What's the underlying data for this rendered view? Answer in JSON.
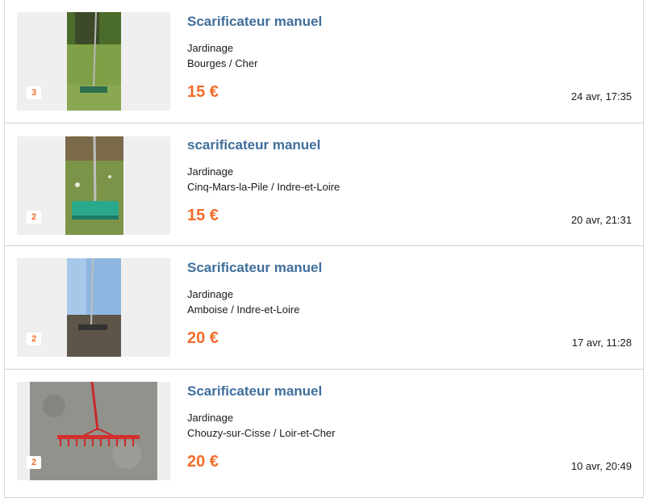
{
  "listings": [
    {
      "title": "Scarificateur manuel",
      "category": "Jardinage",
      "location": "Bourges / Cher",
      "price": "15 €",
      "date": "24 avr, 17:35",
      "photo_count": "3"
    },
    {
      "title": "scarificateur manuel",
      "category": "Jardinage",
      "location": "Cinq-Mars-la-Pile / Indre-et-Loire",
      "price": "15 €",
      "date": "20 avr, 21:31",
      "photo_count": "2"
    },
    {
      "title": "Scarificateur manuel",
      "category": "Jardinage",
      "location": "Amboise / Indre-et-Loire",
      "price": "20 €",
      "date": "17 avr, 11:28",
      "photo_count": "2"
    },
    {
      "title": "Scarificateur manuel",
      "category": "Jardinage",
      "location": "Chouzy-sur-Cisse / Loir-et-Cher",
      "price": "20 €",
      "date": "10 avr, 20:49",
      "photo_count": "2"
    }
  ],
  "colors": {
    "title": "#3f6e9c",
    "price": "#f56b2a",
    "text": "#1a1a1a",
    "divider": "#d3d3d3"
  }
}
